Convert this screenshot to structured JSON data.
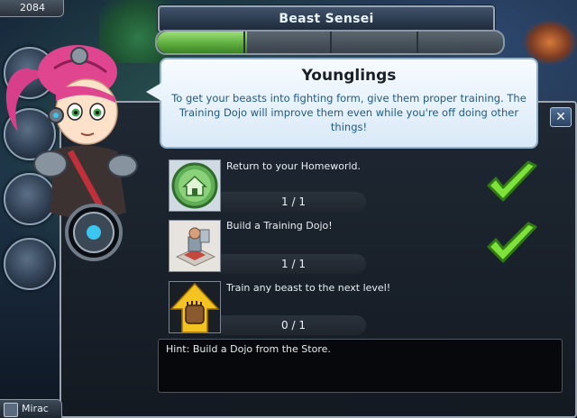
{
  "hud": {
    "coins": "2084",
    "bottom_tab_label": "Mirac"
  },
  "quest": {
    "title": "Beast Sensei",
    "progress": 0.26,
    "segments": 4
  },
  "dialog": {
    "title": "Younglings",
    "body": "To get your beasts into fighting form, give them proper training. The Training Dojo will improve them even while you're off doing other things!"
  },
  "tasks": [
    {
      "text": "Return to your Homeworld.",
      "progress": "1 / 1",
      "completed": true,
      "icon": "home-icon"
    },
    {
      "text": "Build a Training Dojo!",
      "progress": "1 / 1",
      "completed": true,
      "icon": "dojo-icon"
    },
    {
      "text": "Train any beast to the next level!",
      "progress": "0 / 1",
      "completed": false,
      "icon": "train-icon"
    }
  ],
  "hint": "Hint: Build a Dojo from the Store.",
  "colors": {
    "accent_green": "#5fae3f",
    "check_green": "#7ee23a",
    "dialog_text_blue": "#1e5a86",
    "panel_border": "#9aa5b1"
  }
}
